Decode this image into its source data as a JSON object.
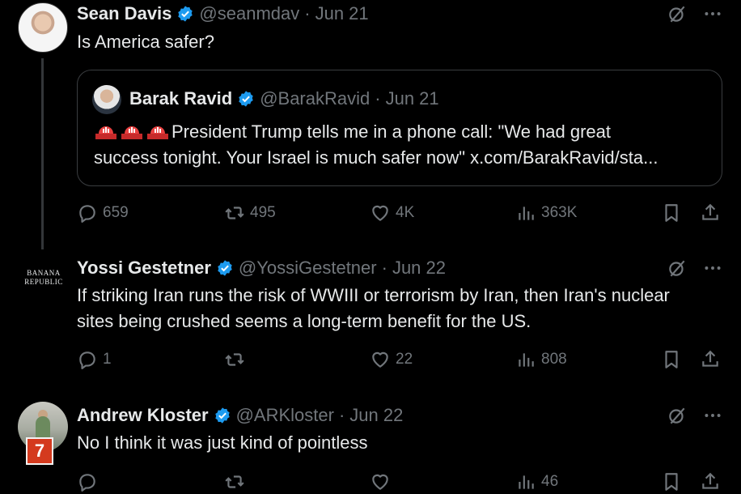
{
  "tweets": [
    {
      "name": "Sean Davis",
      "handle": "@seanmdav",
      "sep": "·",
      "date": "Jun 21",
      "text": "Is America safer?",
      "quote": {
        "name": "Barak Ravid",
        "handle": "@BarakRavid",
        "sep": "·",
        "date": "Jun 21",
        "line1": "President Trump tells me in a phone call: \"We had great",
        "line2": "success tonight. Your Israel is much safer now\" x.com/BarakRavid/sta..."
      },
      "actions": {
        "replies": "659",
        "reposts": "495",
        "likes": "4K",
        "views": "363K"
      }
    },
    {
      "name": "Yossi Gestetner",
      "handle": "@YossiGestetner",
      "sep": "·",
      "date": "Jun 22",
      "avatar_text": [
        "BANANA",
        "REPUBLIC"
      ],
      "line1": "If striking Iran runs the risk of WWIII or terrorism by Iran, then Iran's nuclear",
      "line2": "sites being crushed seems a long-term benefit for the US.",
      "actions": {
        "replies": "1",
        "reposts": "",
        "likes": "22",
        "views": "808"
      }
    },
    {
      "name": "Andrew Kloster",
      "handle": "@ARKloster",
      "sep": "·",
      "date": "Jun 22",
      "text": "No I think it was just kind of pointless",
      "badge": "7",
      "actions": {
        "replies": "",
        "reposts": "",
        "likes": "",
        "views": "46"
      }
    }
  ],
  "colors": {
    "background": "#000000",
    "text": "#e7e9ea",
    "muted": "#71767b",
    "verified": "#1d9bf0",
    "badge": "#d43a1e"
  },
  "icons": [
    "verified-badge-icon",
    "grok-icon",
    "more-icon",
    "reply-icon",
    "repost-icon",
    "like-icon",
    "views-icon",
    "bookmark-icon",
    "share-icon",
    "siren-emoji-icon"
  ]
}
